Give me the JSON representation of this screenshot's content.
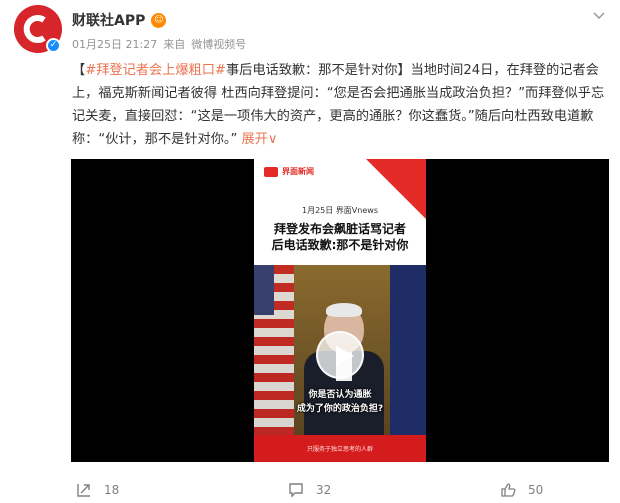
{
  "post": {
    "username": "财联社APP",
    "timestamp": "01月25日 21:27",
    "source_prefix": "来自",
    "source": "微博视频号",
    "topic": "#拜登记者会上爆粗口#",
    "body": "事后电话致歉：那不是针对你】当地时间24日，在拜登的记者会上，福克斯新闻记者彼得 杜西向拜登提问：“您是否会把通胀当成政治负担？”而拜登似乎忘记关麦，直接回怼：“这是一项伟大的资产，更高的通胀？你这蠢货。”随后向杜西致电道歉称：“伙计，那不是针对你。”",
    "open_bracket": "【",
    "expand_label": "展开",
    "expand_arrow": "∨"
  },
  "video": {
    "source_label": "界面新闻",
    "dateline": "1月25日 界面Vnews",
    "headline_1": "拜登发布会飙脏话骂记者",
    "headline_2": "后电话致歉:那不是针对你",
    "subtitle_1": "你是否认为通胀",
    "subtitle_2": "成为了你的政治负担?",
    "footer_text": "只服务于独立思考的人群"
  },
  "actions": {
    "repost_count": "18",
    "comment_count": "32",
    "like_count": "50"
  },
  "colors": {
    "accent": "#eb7350",
    "avatar_red": "#d6262b",
    "verified_blue": "#1a8cff"
  }
}
